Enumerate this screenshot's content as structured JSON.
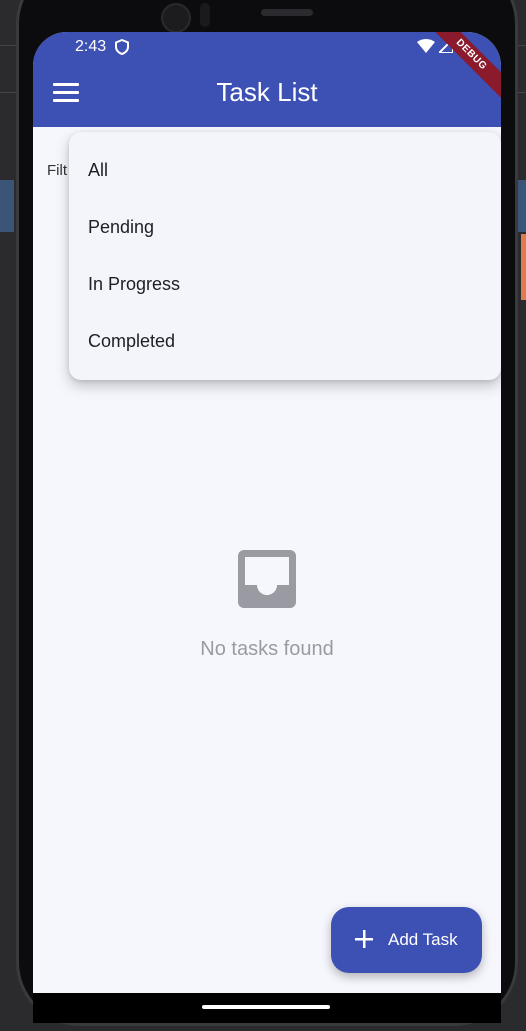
{
  "status_bar": {
    "time": "2:43"
  },
  "app_bar": {
    "title": "Task List",
    "debug_banner": "DEBUG"
  },
  "filter": {
    "label_partial": "Filt"
  },
  "dropdown": {
    "options": [
      "All",
      "Pending",
      "In Progress",
      "Completed"
    ]
  },
  "empty_state": {
    "icon": "inbox-icon",
    "message": "No tasks found"
  },
  "fab": {
    "icon": "plus-icon",
    "label": "Add Task"
  },
  "colors": {
    "primary": "#3d50b4",
    "background": "#f6f7fd",
    "muted_text": "#9a9aa2",
    "debug_banner": "#8b1a2c"
  }
}
